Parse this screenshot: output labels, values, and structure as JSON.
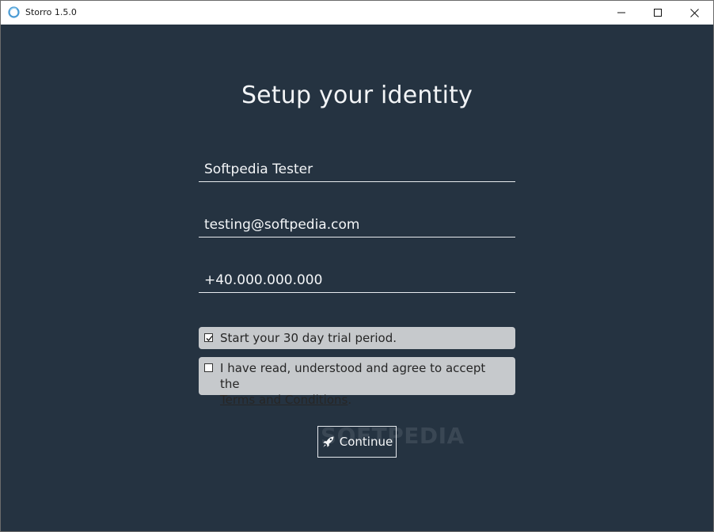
{
  "window": {
    "title": "Storro 1.5.0"
  },
  "page": {
    "heading": "Setup your identity"
  },
  "form": {
    "name_value": "Softpedia Tester",
    "email_value": "testing@softpedia.com",
    "phone_value": "+40.000.000.000"
  },
  "options": {
    "trial": {
      "label": "Start your 30 day trial period.",
      "checked": true
    },
    "terms": {
      "label_prefix": "I have read, understood and agree to accept the",
      "link_text": "Terms and Conditions",
      "label_suffix": ".",
      "checked": false
    }
  },
  "actions": {
    "continue_label": "Continue"
  },
  "watermark": {
    "text": "SOFTPEDIA"
  },
  "colors": {
    "background": "#253341",
    "option_box": "#c6c9cc",
    "text_light": "#f4f6f8"
  },
  "icons": {
    "app": "storro-logo-icon",
    "continue": "rocket-icon"
  }
}
